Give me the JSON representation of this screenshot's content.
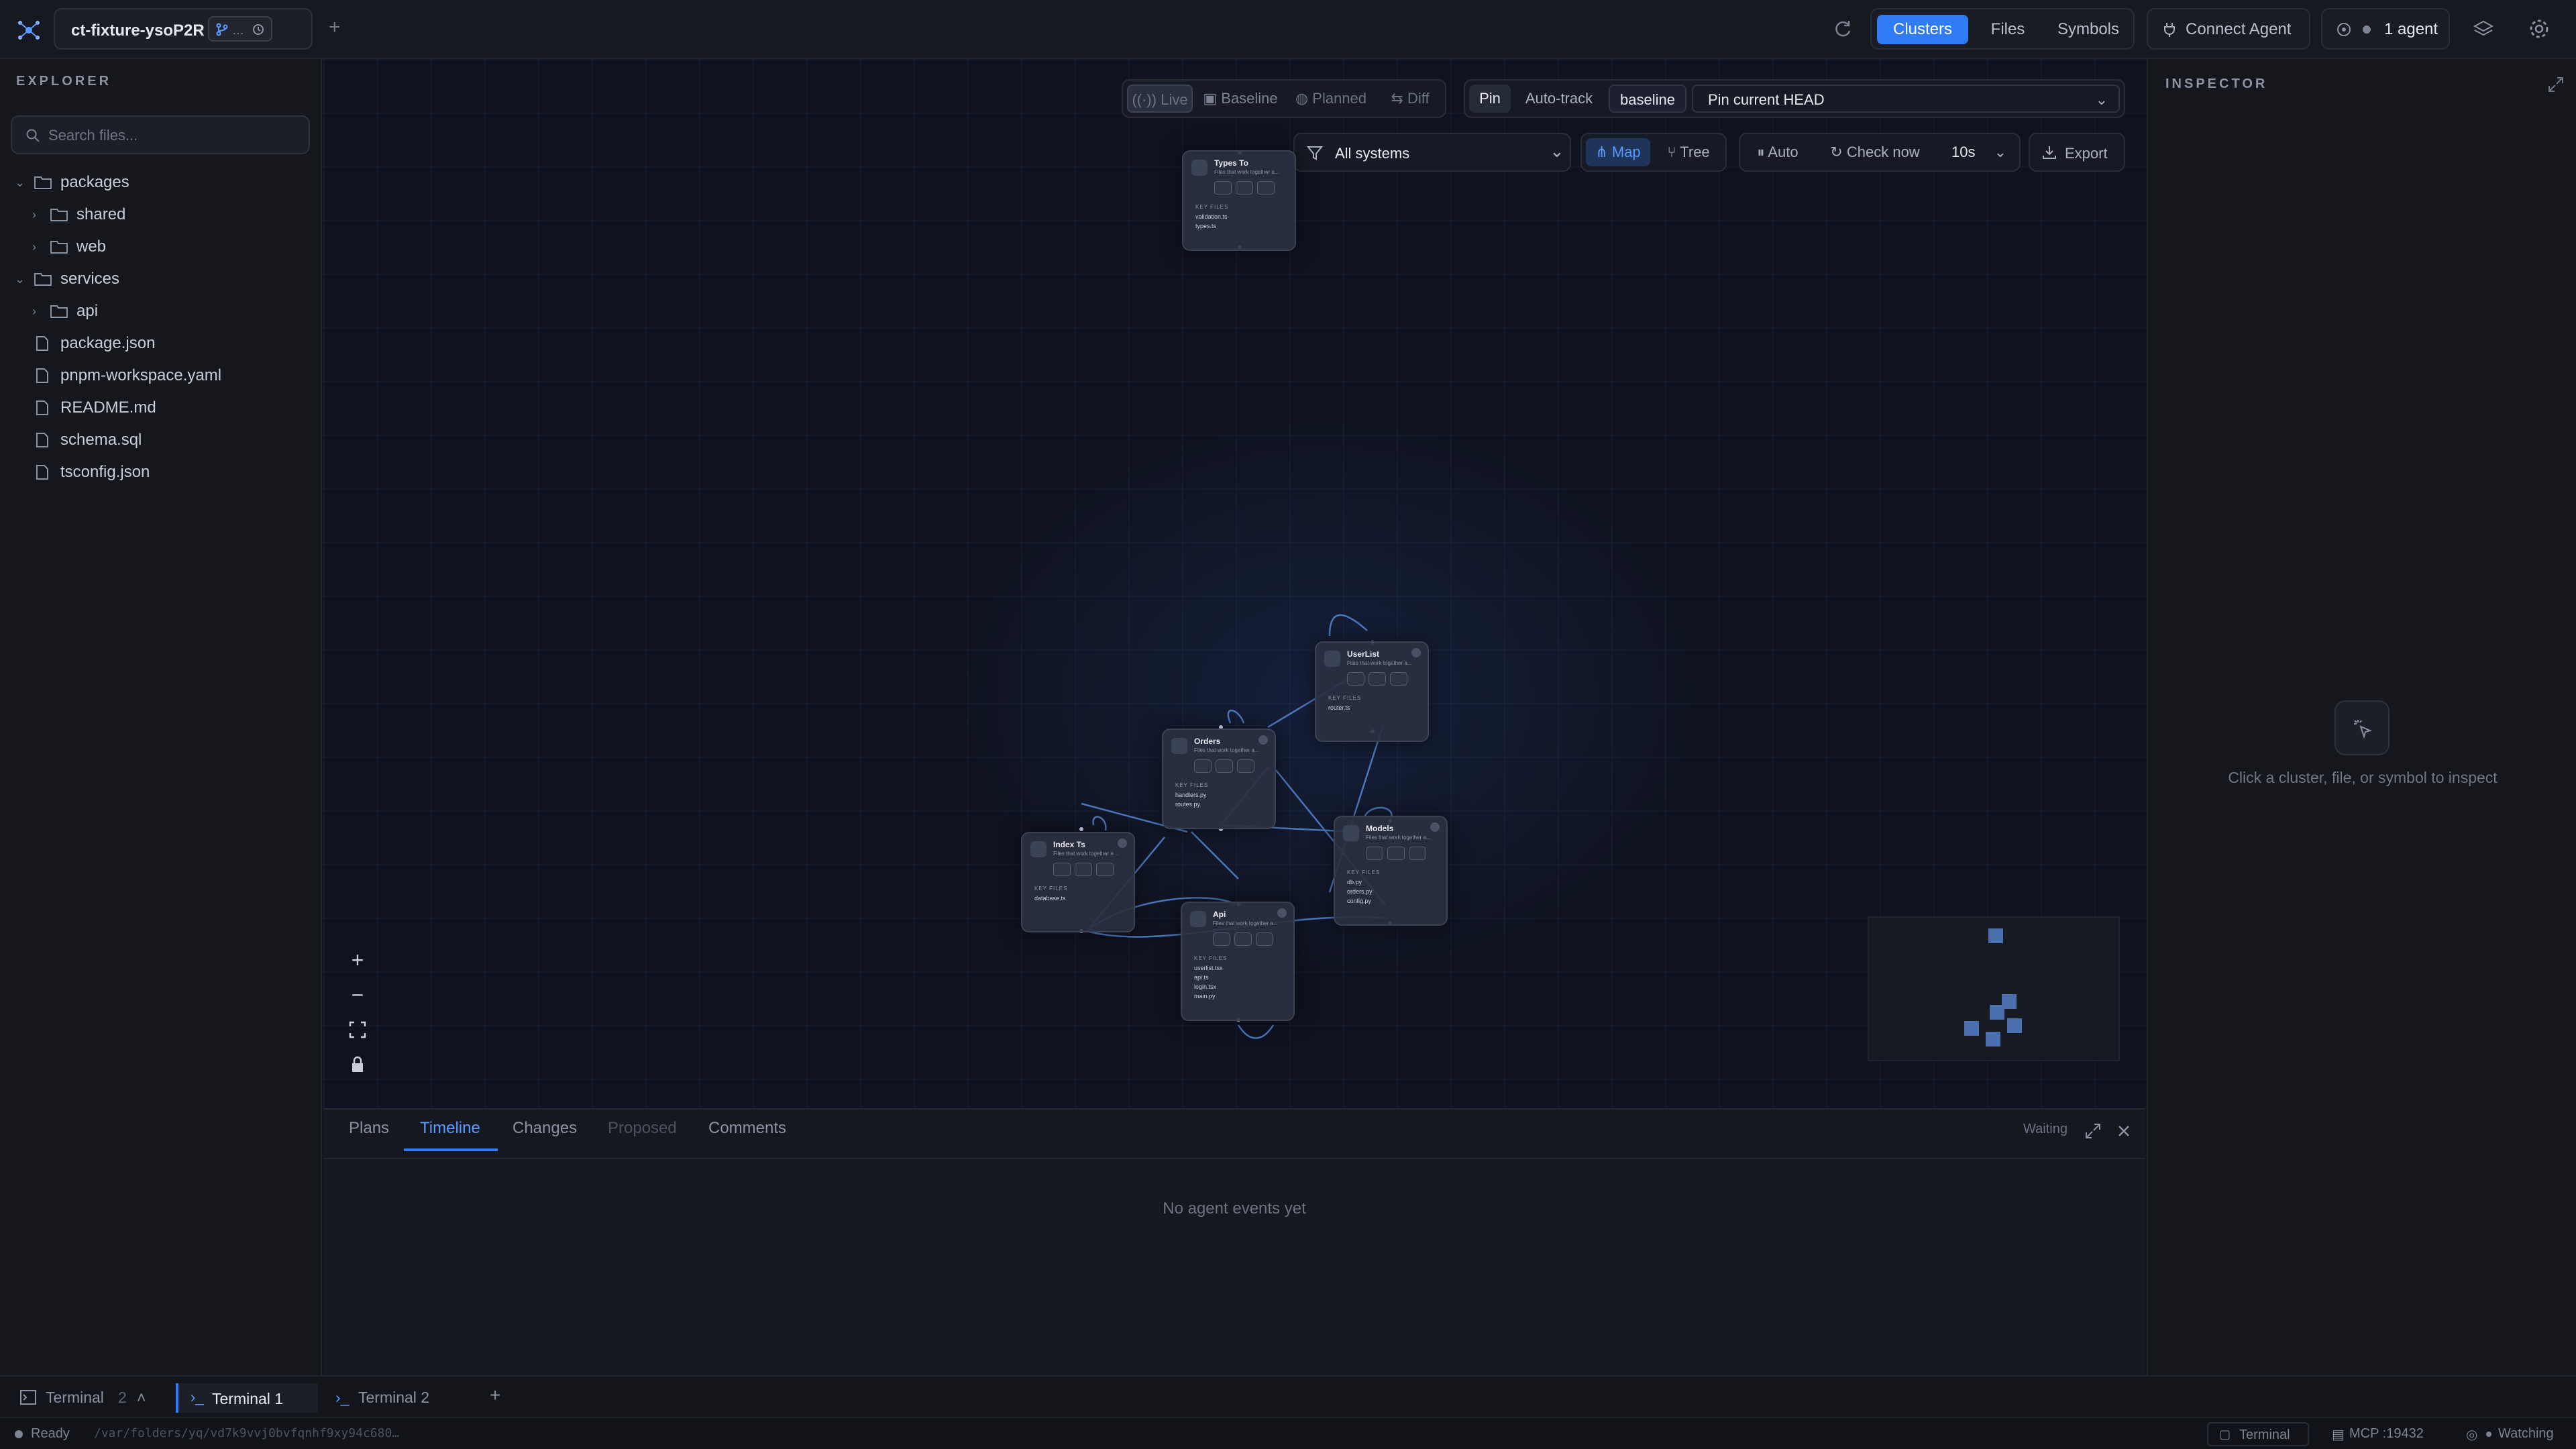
{
  "topbar": {
    "project_name": "ct-fixture-ysoP2R",
    "branch_badge": "…",
    "views": [
      "Clusters",
      "Files",
      "Symbols"
    ],
    "active_view": "Clusters",
    "connect_label": "Connect Agent",
    "agent_count": "1 agent"
  },
  "sidebar": {
    "title": "EXPLORER",
    "search_placeholder": "Search files...",
    "items": [
      {
        "label": "packages",
        "kind": "folder",
        "depth": 0,
        "expanded": true
      },
      {
        "label": "shared",
        "kind": "folder",
        "depth": 1,
        "expanded": false
      },
      {
        "label": "web",
        "kind": "folder",
        "depth": 1,
        "expanded": false
      },
      {
        "label": "services",
        "kind": "folder",
        "depth": 0,
        "expanded": true
      },
      {
        "label": "api",
        "kind": "folder",
        "depth": 1,
        "expanded": false
      },
      {
        "label": "package.json",
        "kind": "file",
        "depth": 0
      },
      {
        "label": "pnpm-workspace.yaml",
        "kind": "file",
        "depth": 0
      },
      {
        "label": "README.md",
        "kind": "file",
        "depth": 0
      },
      {
        "label": "schema.sql",
        "kind": "file",
        "depth": 0
      },
      {
        "label": "tsconfig.json",
        "kind": "file",
        "depth": 0
      }
    ]
  },
  "toolbar": {
    "modes": [
      "Live",
      "Baseline",
      "Planned",
      "Diff"
    ],
    "pin": "Pin",
    "auto_track": "Auto-track",
    "baseline": "baseline",
    "pin_head": "Pin current HEAD",
    "systems": "All systems",
    "map": "Map",
    "tree": "Tree",
    "auto": "Auto",
    "check_now": "Check now",
    "interval": "10s",
    "export": "Export"
  },
  "graph": {
    "nodes": [
      {
        "title": "Types To",
        "subtitle": "Files that work together a...",
        "key": "KEY FILES",
        "files": [
          "validation.ts",
          "types.ts"
        ]
      },
      {
        "title": "UserList",
        "subtitle": "Files that work together a...",
        "key": "KEY FILES",
        "files": [
          "router.ts"
        ]
      },
      {
        "title": "Orders",
        "subtitle": "Files that work together a...",
        "key": "KEY FILES",
        "files": [
          "handlers.py",
          "routes.py"
        ]
      },
      {
        "title": "Index Ts",
        "subtitle": "Files that work together a...",
        "key": "KEY FILES",
        "files": [
          "database.ts"
        ]
      },
      {
        "title": "Models",
        "subtitle": "Files that work together a...",
        "key": "KEY FILES",
        "files": [
          "db.py",
          "orders.py",
          "config.py"
        ]
      },
      {
        "title": "Api",
        "subtitle": "Files that work together a...",
        "key": "KEY FILES",
        "files": [
          "userlist.tsx",
          "api.ts",
          "login.tsx",
          "main.py"
        ]
      }
    ]
  },
  "bottom_panel": {
    "tabs": [
      "Plans",
      "Timeline",
      "Changes",
      "Proposed",
      "Comments"
    ],
    "active_tab": "Timeline",
    "status": "Waiting",
    "empty": "No agent events yet"
  },
  "inspector": {
    "title": "INSPECTOR",
    "hint": "Click a cluster, file, or symbol to inspect"
  },
  "terminal": {
    "label": "Terminal",
    "count": "2",
    "tabs": [
      "Terminal 1",
      "Terminal 2"
    ]
  },
  "status": {
    "ready": "Ready",
    "path": "/var/folders/yq/vd7k9vvj0bvfqnhf9xy94c680…",
    "terminal": "Terminal",
    "mcp": "MCP :19432",
    "watching": "Watching"
  }
}
